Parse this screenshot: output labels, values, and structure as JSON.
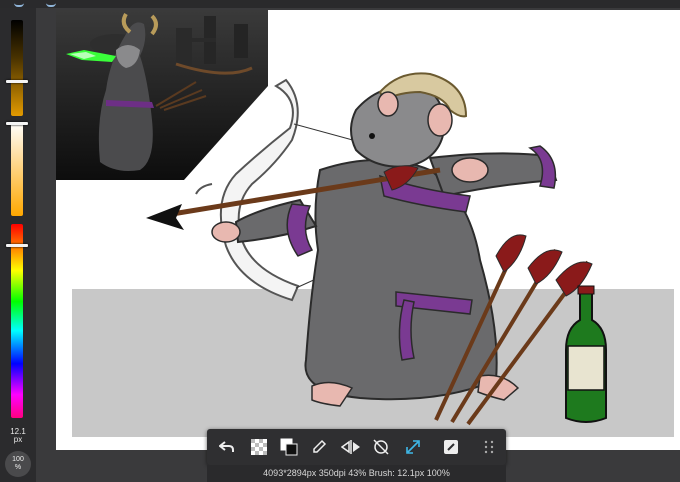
{
  "left_panel": {
    "brush_size_value": "12.1",
    "brush_size_unit": "px",
    "zoom_value": "100",
    "zoom_unit": "%"
  },
  "toolbar": {
    "tools": [
      "undo",
      "transparency-layer",
      "color-swap",
      "eyedropper",
      "symmetry",
      "rotation-lock",
      "fit-to-screen",
      "edit-layer",
      "more"
    ]
  },
  "status_bar": {
    "text": "4093*2894px 350dpi 43% Brush: 12.1px 100%"
  },
  "colors": {
    "accent": "#3fb8e8",
    "robe": "#6a6a6c",
    "sash": "#7a3a92",
    "bottle": "#1e7a1e"
  }
}
